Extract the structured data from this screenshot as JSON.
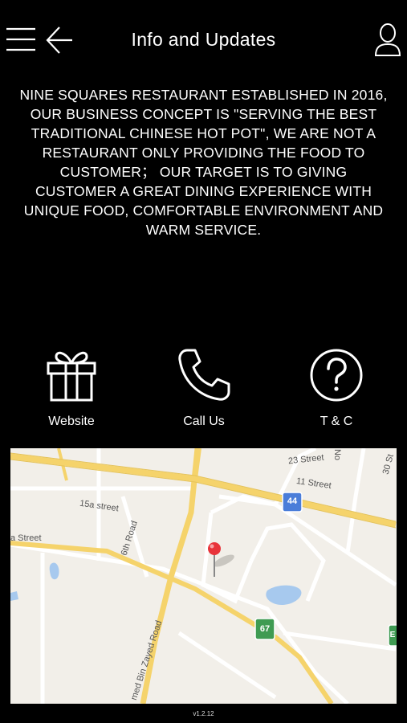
{
  "header": {
    "title": "Info and Updates",
    "menu_icon": "hamburger-menu-icon",
    "back_icon": "back-arrow-icon",
    "profile_icon": "user-profile-icon"
  },
  "about": {
    "text": "Nine Squares Restaurant established in 2016, our business concept is \"serving the best traditional Chinese hot pot\", we are not a restaurant only providing the food to customer； our target is to giving customer a great dining experience with unique food, comfortable environment and warm service."
  },
  "actions": [
    {
      "label": "Website",
      "icon": "gift-icon"
    },
    {
      "label": "Call Us",
      "icon": "phone-icon"
    },
    {
      "label": "T & C",
      "icon": "question-icon"
    }
  ],
  "map": {
    "labels": {
      "street_23": "23 Street",
      "street_11": "11 Street",
      "street_15a": "15a street",
      "road_6th": "6th Road",
      "a_street": "a Street",
      "zayed_road": "med Bin Zayed Road",
      "street_30": "30 St",
      "no": "No"
    },
    "shields": {
      "s44": "44",
      "s67": "67",
      "s_right": "E"
    },
    "pin_color": "#e8333a"
  },
  "version": "v1.2.12"
}
